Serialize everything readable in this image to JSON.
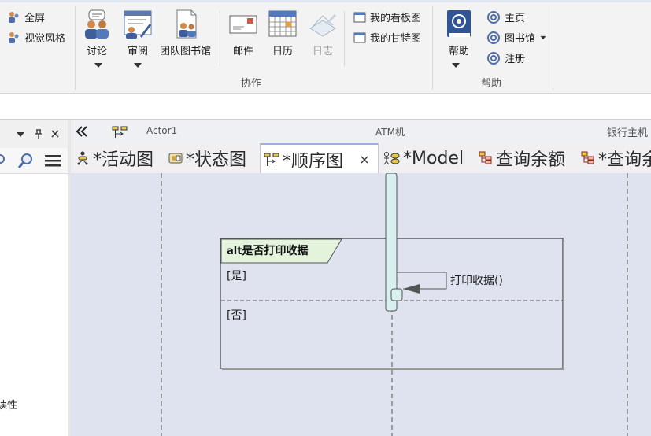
{
  "ribbon": {
    "fullscreen_label": "全屏",
    "visual_style_label": "视觉风格",
    "discuss_label": "讨论",
    "review_label": "审阅",
    "team_library_label": "团队图书馆",
    "mail_label": "邮件",
    "calendar_label": "日历",
    "journal_label": "日志",
    "my_kanban_label": "我的看板图",
    "my_gantt_label": "我的甘特图",
    "collab_group_label": "协作",
    "help_label": "帮助",
    "home_label": "主页",
    "library_label": "图书馆",
    "register_label": "注册",
    "help_group_label": "帮助"
  },
  "left_panel": {
    "partial_text": "读性"
  },
  "lifelines": {
    "actor": "Actor1",
    "atm": "ATM机",
    "bank": "银行主机"
  },
  "tabs": [
    {
      "label": "*活动图"
    },
    {
      "label": "*状态图"
    },
    {
      "label": "*顺序图",
      "active": true
    },
    {
      "label": "*Model"
    },
    {
      "label": "查询余额"
    },
    {
      "label": "*查询余"
    }
  ],
  "diagram": {
    "fragment_operator": "alt",
    "fragment_title": "是否打印收据",
    "guard_yes": "[是]",
    "guard_no": "[否]",
    "message_label": "打印收据()"
  },
  "colors": {
    "canvas_bg": "#dfe2ef",
    "activation_fill": "#d8f0f0",
    "fragment_tag_fill": "#e3f3dc"
  }
}
